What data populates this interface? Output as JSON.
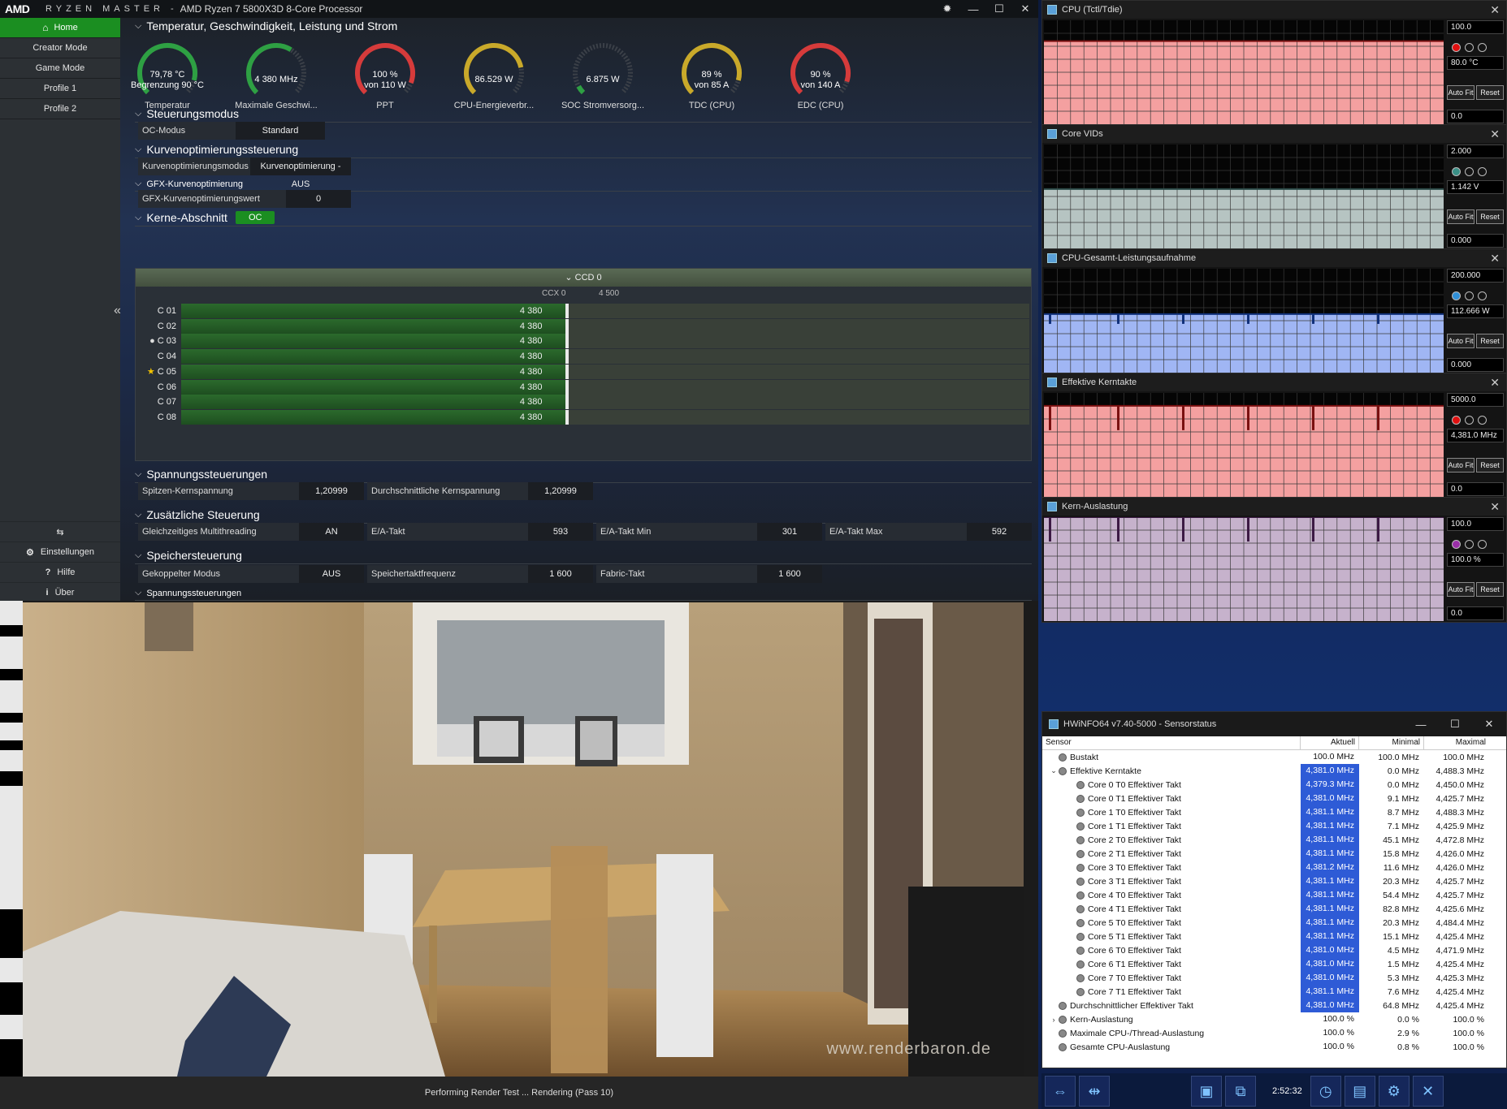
{
  "ryzen_master": {
    "logo": "AMD",
    "brand": "RYZEN MASTER",
    "separator": "-",
    "cpu_name": "AMD Ryzen 7 5800X3D 8-Core Processor",
    "nav": [
      {
        "label": "Home",
        "active": true
      },
      {
        "label": "Creator Mode"
      },
      {
        "label": "Game Mode"
      },
      {
        "label": "Profile 1"
      },
      {
        "label": "Profile 2"
      }
    ],
    "bottom_nav": [
      {
        "label": "Einstellungen"
      },
      {
        "label": "Hilfe"
      },
      {
        "label": "Über"
      }
    ],
    "sections": {
      "temp": "Temperatur, Geschwindigkeit, Leistung und Strom",
      "control": "Steuerungsmodus",
      "curve": "Kurvenoptimierungssteuerung",
      "gfx": "GFX-Kurvenoptimierung",
      "cores": "Kerne-Abschnitt",
      "voltage": "Spannungssteuerungen",
      "extra": "Zusätzliche Steuerung",
      "memory": "Speichersteuerung",
      "voltage2": "Spannungssteuerungen"
    },
    "gauges": [
      {
        "value": "79,78 °C",
        "sub": "Begrenzung 90 °C",
        "label": "Temperatur",
        "fraction": 0.89,
        "color": "#2ea043"
      },
      {
        "value": "4 380  MHz",
        "sub": "",
        "label": "Maximale Geschwi...",
        "fraction": 0.62,
        "color": "#2ea043"
      },
      {
        "value": "100 %",
        "sub": "von 110 W",
        "label": "PPT",
        "fraction": 0.91,
        "color": "#d63b3b"
      },
      {
        "value": "86.529 W",
        "sub": "",
        "label": "CPU-Energieverbr...",
        "fraction": 0.79,
        "color": "#c9a92a"
      },
      {
        "value": "6.875 W",
        "sub": "",
        "label": "SOC Stromversorg...",
        "fraction": 0.06,
        "color": "#2ea043"
      },
      {
        "value": "89 %",
        "sub": "von 85 A",
        "label": "TDC (CPU)",
        "fraction": 0.89,
        "color": "#c9a92a"
      },
      {
        "value": "90 %",
        "sub": "von 140 A",
        "label": "EDC (CPU)",
        "fraction": 0.9,
        "color": "#d63b3b"
      }
    ],
    "oc_mode": {
      "label": "OC-Modus",
      "value": "Standard"
    },
    "curve_mode": {
      "label": "Kurvenoptimierungsmodus",
      "value": "Kurvenoptimierung - AUS"
    },
    "gfx_curve": {
      "label": "GFX-Kurvenoptimierungswert",
      "value": "0"
    },
    "cores_badge": "OC",
    "ccd": {
      "title": "CCD 0",
      "ccx": "CCX 0",
      "scale": "4 500"
    },
    "cores": [
      {
        "name": "C 01",
        "value": "4 380",
        "marker": ""
      },
      {
        "name": "C 02",
        "value": "4 380",
        "marker": ""
      },
      {
        "name": "C 03",
        "value": "4 380",
        "marker": "●"
      },
      {
        "name": "C 04",
        "value": "4 380",
        "marker": ""
      },
      {
        "name": "C 05",
        "value": "4 380",
        "marker": "★"
      },
      {
        "name": "C 06",
        "value": "4 380",
        "marker": ""
      },
      {
        "name": "C 07",
        "value": "4 380",
        "marker": ""
      },
      {
        "name": "C 08",
        "value": "4 380",
        "marker": ""
      }
    ],
    "voltage": [
      {
        "label": "Spitzen-Kernspannung",
        "value": "1,20999"
      },
      {
        "label": "Durchschnittliche Kernspannung",
        "value": "1,20999"
      }
    ],
    "extra": [
      {
        "label": "Gleichzeitiges Multithreading",
        "value": "AN"
      },
      {
        "label": "E/A-Takt",
        "value": "593"
      },
      {
        "label": "E/A-Takt Min",
        "value": "301"
      },
      {
        "label": "E/A-Takt Max",
        "value": "592"
      }
    ],
    "memory": [
      {
        "label": "Gekoppelter Modus",
        "value": "AUS"
      },
      {
        "label": "Speichertaktfrequenz",
        "value": "1 600"
      },
      {
        "label": "Fabric-Takt",
        "value": "1 600"
      }
    ]
  },
  "render": {
    "status": "Performing Render Test ... Rendering (Pass 10)",
    "watermark": "www.renderbaron.de"
  },
  "graphs": [
    {
      "title": "CPU (Tctl/Tdie)",
      "max": "100.0",
      "current": "80.0 °C",
      "min": "0.0",
      "level": 0.8,
      "fill": "#f4a0a0",
      "line": "#7a1010",
      "dot": "#e01010",
      "spikes": false
    },
    {
      "title": "Core VIDs",
      "max": "2.000",
      "current": "1.142 V",
      "min": "0.000",
      "level": 0.571,
      "fill": "#b6c4c2",
      "line": "#2d4b48",
      "dot": "#3a8f86",
      "spikes": false
    },
    {
      "title": "CPU-Gesamt-Leistungsaufnahme",
      "max": "200.000",
      "current": "112.666 W",
      "min": "0.000",
      "level": 0.563,
      "fill": "#a0b6f4",
      "line": "#10307a",
      "dot": "#2f8fd8",
      "spikes": true
    },
    {
      "title": "Effektive Kerntakte",
      "max": "5000.0",
      "current": "4,381.0 MHz",
      "min": "0.0",
      "level": 0.876,
      "fill": "#f4a0a0",
      "line": "#7a1010",
      "dot": "#e01010",
      "spikes": true
    },
    {
      "title": "Kern-Auslastung",
      "max": "100.0",
      "current": "100.0 %",
      "min": "0.0",
      "level": 1.0,
      "fill": "#c6b2cc",
      "line": "#3c1a44",
      "dot": "#9a2fa8",
      "spikes": true
    }
  ],
  "graph_buttons": {
    "autofit": "Auto Fit",
    "reset": "Reset"
  },
  "sensor": {
    "title": "HWiNFO64 v7.40-5000 - Sensorstatus",
    "headers": [
      "Sensor",
      "Aktuell",
      "Minimal",
      "Maximal"
    ],
    "rows": [
      {
        "name": "Bustakt",
        "cur": "100.0 MHz",
        "min": "100.0 MHz",
        "max": "100.0 MHz",
        "indent": 1,
        "hl": false,
        "exp": ""
      },
      {
        "name": "Effektive Kerntakte",
        "cur": "4,381.0 MHz",
        "min": "0.0 MHz",
        "max": "4,488.3 MHz",
        "indent": 1,
        "hl": true,
        "exp": "⌄"
      },
      {
        "name": "Core 0 T0 Effektiver Takt",
        "cur": "4,379.3 MHz",
        "min": "0.0 MHz",
        "max": "4,450.0 MHz",
        "indent": 2,
        "hl": true,
        "exp": ""
      },
      {
        "name": "Core 0 T1 Effektiver Takt",
        "cur": "4,381.0 MHz",
        "min": "9.1 MHz",
        "max": "4,425.7 MHz",
        "indent": 2,
        "hl": true,
        "exp": ""
      },
      {
        "name": "Core 1 T0 Effektiver Takt",
        "cur": "4,381.1 MHz",
        "min": "8.7 MHz",
        "max": "4,488.3 MHz",
        "indent": 2,
        "hl": true,
        "exp": ""
      },
      {
        "name": "Core 1 T1 Effektiver Takt",
        "cur": "4,381.1 MHz",
        "min": "7.1 MHz",
        "max": "4,425.9 MHz",
        "indent": 2,
        "hl": true,
        "exp": ""
      },
      {
        "name": "Core 2 T0 Effektiver Takt",
        "cur": "4,381.1 MHz",
        "min": "45.1 MHz",
        "max": "4,472.8 MHz",
        "indent": 2,
        "hl": true,
        "exp": ""
      },
      {
        "name": "Core 2 T1 Effektiver Takt",
        "cur": "4,381.1 MHz",
        "min": "15.8 MHz",
        "max": "4,426.0 MHz",
        "indent": 2,
        "hl": true,
        "exp": ""
      },
      {
        "name": "Core 3 T0 Effektiver Takt",
        "cur": "4,381.2 MHz",
        "min": "11.6 MHz",
        "max": "4,426.0 MHz",
        "indent": 2,
        "hl": true,
        "exp": ""
      },
      {
        "name": "Core 3 T1 Effektiver Takt",
        "cur": "4,381.1 MHz",
        "min": "20.3 MHz",
        "max": "4,425.7 MHz",
        "indent": 2,
        "hl": true,
        "exp": ""
      },
      {
        "name": "Core 4 T0 Effektiver Takt",
        "cur": "4,381.1 MHz",
        "min": "54.4 MHz",
        "max": "4,425.7 MHz",
        "indent": 2,
        "hl": true,
        "exp": ""
      },
      {
        "name": "Core 4 T1 Effektiver Takt",
        "cur": "4,381.1 MHz",
        "min": "82.8 MHz",
        "max": "4,425.6 MHz",
        "indent": 2,
        "hl": true,
        "exp": ""
      },
      {
        "name": "Core 5 T0 Effektiver Takt",
        "cur": "4,381.1 MHz",
        "min": "20.3 MHz",
        "max": "4,484.4 MHz",
        "indent": 2,
        "hl": true,
        "exp": ""
      },
      {
        "name": "Core 5 T1 Effektiver Takt",
        "cur": "4,381.1 MHz",
        "min": "15.1 MHz",
        "max": "4,425.4 MHz",
        "indent": 2,
        "hl": true,
        "exp": ""
      },
      {
        "name": "Core 6 T0 Effektiver Takt",
        "cur": "4,381.0 MHz",
        "min": "4.5 MHz",
        "max": "4,471.9 MHz",
        "indent": 2,
        "hl": true,
        "exp": ""
      },
      {
        "name": "Core 6 T1 Effektiver Takt",
        "cur": "4,381.0 MHz",
        "min": "1.5 MHz",
        "max": "4,425.4 MHz",
        "indent": 2,
        "hl": true,
        "exp": ""
      },
      {
        "name": "Core 7 T0 Effektiver Takt",
        "cur": "4,381.0 MHz",
        "min": "5.3 MHz",
        "max": "4,425.3 MHz",
        "indent": 2,
        "hl": true,
        "exp": ""
      },
      {
        "name": "Core 7 T1 Effektiver Takt",
        "cur": "4,381.1 MHz",
        "min": "7.6 MHz",
        "max": "4,425.4 MHz",
        "indent": 2,
        "hl": true,
        "exp": ""
      },
      {
        "name": "Durchschnittlicher Effektiver Takt",
        "cur": "4,381.0 MHz",
        "min": "64.8 MHz",
        "max": "4,425.4 MHz",
        "indent": 1,
        "hl": true,
        "exp": ""
      },
      {
        "name": "Kern-Auslastung",
        "cur": "100.0 %",
        "min": "0.0 %",
        "max": "100.0 %",
        "indent": 1,
        "hl": false,
        "exp": "›"
      },
      {
        "name": "Maximale CPU-/Thread-Auslastung",
        "cur": "100.0 %",
        "min": "2.9 %",
        "max": "100.0 %",
        "indent": 1,
        "hl": false,
        "exp": ""
      },
      {
        "name": "Gesamte CPU-Auslastung",
        "cur": "100.0 %",
        "min": "0.8 %",
        "max": "100.0 %",
        "indent": 1,
        "hl": false,
        "exp": ""
      }
    ]
  },
  "taskbar": {
    "time": "2:52:32"
  }
}
